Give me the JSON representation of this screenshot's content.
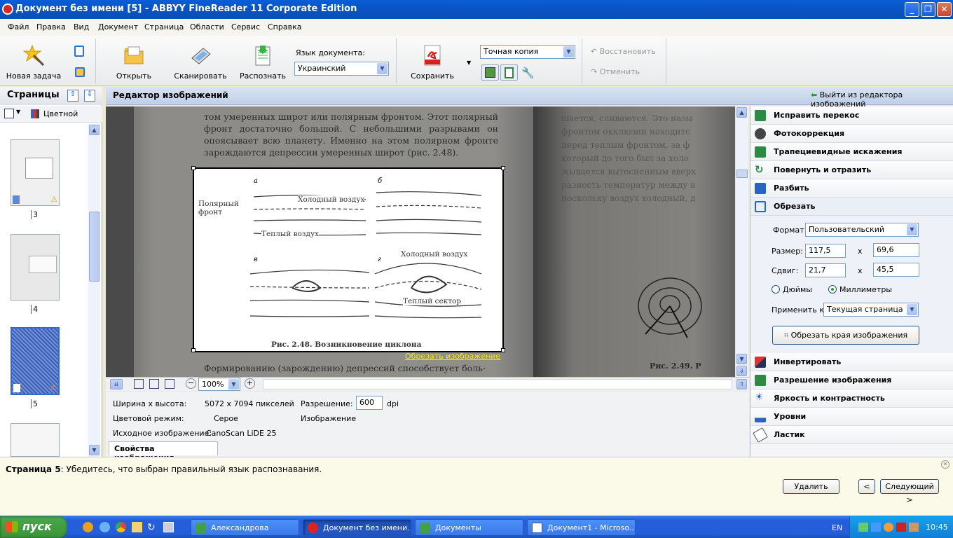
{
  "window": {
    "title": "Документ без имени [5] - ABBYY FineReader 11 Corporate Edition"
  },
  "menu": [
    "Файл",
    "Правка",
    "Вид",
    "Документ",
    "Страница",
    "Области",
    "Сервис",
    "Справка"
  ],
  "toolbar": {
    "new_task": "Новая задача",
    "open": "Открыть",
    "scan": "Сканировать",
    "recognize": "Распознать",
    "doc_lang_label": "Язык документа:",
    "doc_lang_value": "Украинский",
    "save": "Сохранить",
    "save_mode_value": "Точная копия",
    "restore": "Восстановить",
    "cancel": "Отменить"
  },
  "pages_panel": {
    "title": "Страницы",
    "color_mode": "Цветной",
    "pages": [
      "3",
      "4",
      "5"
    ]
  },
  "editor": {
    "title": "Редактор изображений",
    "exit": "Выйти из редактора изображений",
    "crop_link": "Обрезать изображение",
    "zoom": "100%",
    "image_text": {
      "para_top": "том умеренных широт или полярным фронтом. Этот полярный фронт достаточно большой. С небольшими разрывами он опоясывает всю планету. Именно на этом полярном фронте зарождаются депрессии умеренных широт (рис. 2.48).",
      "fig_a": "а",
      "fig_b": "б",
      "fig_v": "в",
      "fig_g": "г",
      "polar_front": "Полярный фронт",
      "cold_air_1": "Холодный воздух",
      "warm_air": "Теплый воздух",
      "cold_air_2": "Холодный воздух",
      "warm_sector": "Теплый сектор",
      "caption": "Рис. 2.48. Возникновение циклона",
      "para_bottom": "Формированию (зарождению) депрессий способствует боль-",
      "right_caption": "Рис. 2.49. Р"
    }
  },
  "tools": {
    "items_top": [
      "Исправить перекос",
      "Фотокоррекция",
      "Трапециевидные искажения",
      "Повернуть и отразить",
      "Разбить",
      "Обрезать"
    ],
    "format_label": "Формат:",
    "format_value": "Пользовательский",
    "size_label": "Размер:",
    "size_w": "117,5",
    "size_h": "69,6",
    "x_sep": "x",
    "offset_label": "Сдвиг:",
    "offset_x": "21,7",
    "offset_y": "45,5",
    "unit_inches": "Дюймы",
    "unit_mm": "Миллиметры",
    "apply_label": "Применить к:",
    "apply_value": "Текущая страница",
    "crop_button": "Обрезать края изображения",
    "items_bottom": [
      "Инвертировать",
      "Разрешение изображения",
      "Яркость и контрастность",
      "Уровни",
      "Ластик"
    ]
  },
  "properties": {
    "wh_label": "Ширина x высота:",
    "wh_value": "5072 x 7094 пикселей",
    "res_label": "Разрешение:",
    "res_value": "600",
    "res_unit": "dpi",
    "color_label": "Цветовой режим:",
    "color_value": "Серое",
    "image_label": "Изображение",
    "source_label": "Исходное изображение:",
    "source_value": "CanoScan LiDE 25",
    "tab": "Свойства изображения"
  },
  "message": {
    "page_bold": "Страница 5",
    "text": ": Убедитесь, что выбран правильный язык распознавания.",
    "delete": "Удалить",
    "prev": "<",
    "next": "Следующий >"
  },
  "taskbar": {
    "start": "пуск",
    "tasks": [
      "Александрова",
      "Документ без имени...",
      "Документы",
      "Документ1 - Microso..."
    ],
    "lang": "EN",
    "time": "10:45"
  }
}
